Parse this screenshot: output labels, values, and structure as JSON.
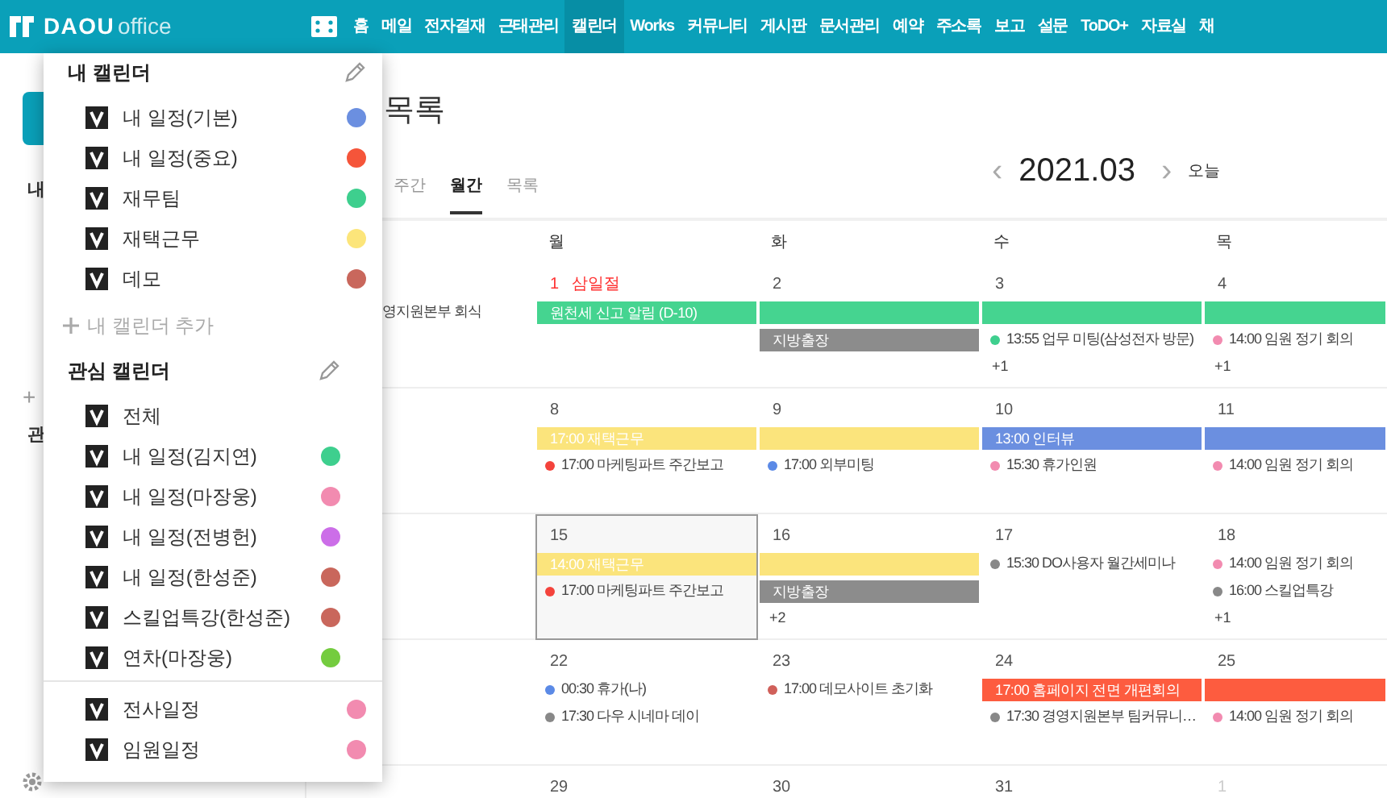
{
  "top_nav": {
    "logo_bold": "DAOU",
    "logo_light": "office",
    "items": [
      {
        "label": "홈",
        "selected": false
      },
      {
        "label": "메일",
        "selected": false
      },
      {
        "label": "전자결재",
        "selected": false
      },
      {
        "label": "근태관리",
        "selected": false
      },
      {
        "label": "캘린더",
        "selected": true
      },
      {
        "label": "Works",
        "selected": false
      },
      {
        "label": "커뮤니티",
        "selected": false
      },
      {
        "label": "게시판",
        "selected": false
      },
      {
        "label": "문서관리",
        "selected": false
      },
      {
        "label": "예약",
        "selected": false
      },
      {
        "label": "주소록",
        "selected": false
      },
      {
        "label": "보고",
        "selected": false
      },
      {
        "label": "설문",
        "selected": false
      },
      {
        "label": "ToDO+",
        "selected": false
      },
      {
        "label": "자료실",
        "selected": false
      },
      {
        "label": "채",
        "selected": false
      }
    ]
  },
  "sidebar": {
    "section_1": "내",
    "add": "+",
    "section_2": "관"
  },
  "main": {
    "title": "목록",
    "view_tabs": [
      {
        "label": "주간",
        "selected": false
      },
      {
        "label": "월간",
        "selected": true
      },
      {
        "label": "목록",
        "selected": false
      }
    ],
    "date_nav": {
      "prev": "‹",
      "period": "2021.03",
      "next": "›",
      "today": "오늘"
    },
    "weekdays": [
      "월",
      "화",
      "수",
      "목"
    ],
    "weeks": [
      {
        "sunday_items": [
          {
            "kind": "event",
            "text": "영지원본부 회식"
          }
        ],
        "days": [
          {
            "label": "1",
            "name": "삼일절",
            "kind": "holiday",
            "selected": false,
            "items": [
              {
                "kind": "bar",
                "text": "원천세 신고 알림 (D-10)",
                "color": "#45d490"
              }
            ]
          },
          {
            "label": "2",
            "kind": "normal",
            "selected": false,
            "items": [
              {
                "kind": "bar-cont",
                "color": "#45d490"
              },
              {
                "kind": "bar",
                "text": "지방출장",
                "color": "#8c8c8c"
              }
            ]
          },
          {
            "label": "3",
            "kind": "normal",
            "selected": false,
            "items": [
              {
                "kind": "bar-cont",
                "color": "#45d490"
              },
              {
                "kind": "event",
                "text": "13:55 업무 미팅(삼성전자 방문)",
                "color": "#3ecf8e"
              },
              {
                "kind": "more",
                "text": "+1"
              }
            ]
          },
          {
            "label": "4",
            "kind": "normal",
            "selected": false,
            "items": [
              {
                "kind": "bar-cont",
                "color": "#45d490"
              },
              {
                "kind": "event",
                "text": "14:00 임원 정기 회의",
                "color": "#f28bb0"
              },
              {
                "kind": "more",
                "text": "+1"
              }
            ]
          }
        ]
      },
      {
        "days": [
          {
            "label": "8",
            "kind": "normal",
            "selected": false,
            "items": [
              {
                "kind": "bar",
                "text": "17:00 재택근무",
                "color": "#fbe47c"
              },
              {
                "kind": "event",
                "text": "17:00 마케팅파트 주간보고",
                "color": "#f4433c"
              }
            ]
          },
          {
            "label": "9",
            "kind": "normal",
            "selected": false,
            "items": [
              {
                "kind": "bar-cont",
                "color": "#fbe47c"
              },
              {
                "kind": "event",
                "text": "17:00 외부미팅",
                "color": "#5b8ae6"
              }
            ]
          },
          {
            "label": "10",
            "kind": "normal",
            "selected": false,
            "items": [
              {
                "kind": "bar",
                "text": "13:00 인터뷰",
                "color": "#6b8fe0"
              },
              {
                "kind": "event",
                "text": "15:30 휴가인원",
                "color": "#f28bb0"
              }
            ]
          },
          {
            "label": "11",
            "kind": "normal",
            "selected": false,
            "items": [
              {
                "kind": "bar-cont",
                "color": "#6b8fe0"
              },
              {
                "kind": "event",
                "text": "14:00 임원 정기 회의",
                "color": "#f28bb0"
              }
            ]
          }
        ]
      },
      {
        "days": [
          {
            "label": "15",
            "kind": "normal",
            "selected": true,
            "items": [
              {
                "kind": "bar",
                "text": "14:00 재택근무",
                "color": "#fbe47c"
              },
              {
                "kind": "event",
                "text": "17:00 마케팅파트 주간보고",
                "color": "#f4433c"
              }
            ]
          },
          {
            "label": "16",
            "kind": "normal",
            "selected": false,
            "items": [
              {
                "kind": "bar-cont",
                "color": "#fbe47c"
              },
              {
                "kind": "bar",
                "text": "지방출장",
                "color": "#8c8c8c"
              },
              {
                "kind": "more",
                "text": "+2"
              }
            ]
          },
          {
            "label": "17",
            "kind": "normal",
            "selected": false,
            "items": [
              {
                "kind": "event",
                "text": "15:30 DO사용자 월간세미나",
                "color": "#888888"
              }
            ]
          },
          {
            "label": "18",
            "kind": "normal",
            "selected": false,
            "items": [
              {
                "kind": "event",
                "text": "14:00 임원 정기 회의",
                "color": "#f28bb0"
              },
              {
                "kind": "event",
                "text": "16:00 스킬업특강",
                "color": "#888888"
              },
              {
                "kind": "more",
                "text": "+1"
              }
            ]
          }
        ]
      },
      {
        "days": [
          {
            "label": "22",
            "kind": "normal",
            "selected": false,
            "items": [
              {
                "kind": "event",
                "text": "00:30 휴가(나)",
                "color": "#5b8ae6"
              },
              {
                "kind": "event",
                "text": "17:30 다우 시네마 데이",
                "color": "#888888"
              }
            ]
          },
          {
            "label": "23",
            "kind": "normal",
            "selected": false,
            "items": [
              {
                "kind": "event",
                "text": "17:00 데모사이트 초기화",
                "color": "#d0605a"
              }
            ]
          },
          {
            "label": "24",
            "kind": "normal",
            "selected": false,
            "items": [
              {
                "kind": "bar",
                "text": "17:00 홈페이지 전면 개편회의",
                "color": "#fd5c3f"
              },
              {
                "kind": "event",
                "text": "17:30 경영지원본부 팀커뮤니…",
                "color": "#888888"
              }
            ]
          },
          {
            "label": "25",
            "kind": "normal",
            "selected": false,
            "items": [
              {
                "kind": "bar-cont",
                "color": "#fd5c3f"
              },
              {
                "kind": "event",
                "text": "14:00 임원 정기 회의",
                "color": "#f28bb0"
              }
            ]
          }
        ]
      },
      {
        "days": [
          {
            "label": "29",
            "kind": "normal",
            "selected": false
          },
          {
            "label": "30",
            "kind": "normal",
            "selected": false
          },
          {
            "label": "31",
            "kind": "normal",
            "selected": false
          },
          {
            "label": "1",
            "kind": "other_month",
            "selected": false
          }
        ]
      }
    ]
  },
  "calendar_dropdown": {
    "groups": [
      {
        "title": "내 캘린더",
        "items": [
          {
            "label": "내 일정(기본)",
            "checked": true,
            "color": "#6b8fe0"
          },
          {
            "label": "내 일정(중요)",
            "checked": true,
            "color": "#f5553a"
          },
          {
            "label": "재무팀",
            "checked": true,
            "color": "#3ecf8e"
          },
          {
            "label": "재택근무",
            "checked": true,
            "color": "#fce57a"
          },
          {
            "label": "데모",
            "checked": true,
            "color": "#c9675c"
          }
        ],
        "add": "내 캘린더 추가"
      },
      {
        "title": "관심 캘린더",
        "items": [
          {
            "label": "전체",
            "checked": true
          },
          {
            "label": "내 일정(김지연)",
            "checked": true,
            "color": "#3ecf8e"
          },
          {
            "label": "내 일정(마장웅)",
            "checked": true,
            "color": "#f28bb0"
          },
          {
            "label": "내 일정(전병헌)",
            "checked": true,
            "color": "#cc6ee8"
          },
          {
            "label": "내 일정(한성준)",
            "checked": true,
            "color": "#c9675c"
          },
          {
            "label": "스킬업특강(한성준)",
            "checked": true,
            "color": "#c9675c"
          },
          {
            "label": "연차(마장웅)",
            "checked": true,
            "color": "#74cc3f"
          }
        ]
      },
      {
        "items": [
          {
            "label": "전사일정",
            "checked": true,
            "color": "#f28bb0"
          },
          {
            "label": "임원일정",
            "checked": true,
            "color": "#f28bb0"
          }
        ]
      }
    ]
  }
}
